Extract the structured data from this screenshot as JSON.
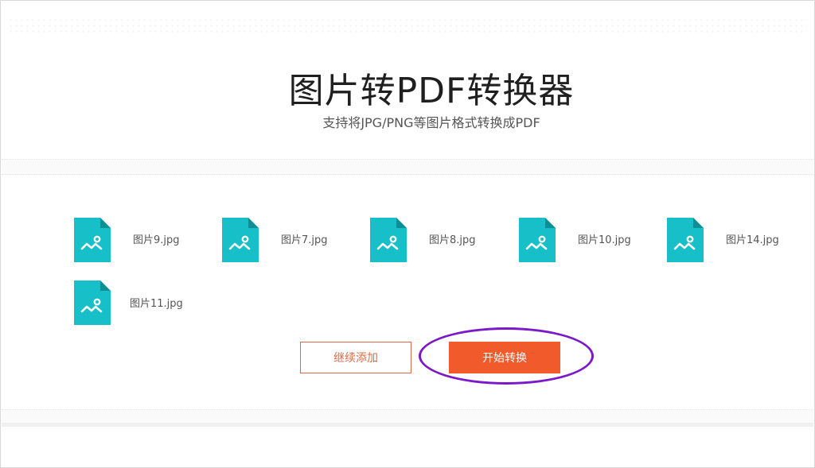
{
  "header": {
    "title": "图片转PDF转换器",
    "subtitle": "支持将JPG/PNG等图片格式转换成PDF"
  },
  "files": [
    {
      "name": "图片9.jpg",
      "icon": "image-file-icon"
    },
    {
      "name": "图片7.jpg",
      "icon": "image-file-icon"
    },
    {
      "name": "图片8.jpg",
      "icon": "image-file-icon"
    },
    {
      "name": "图片10.jpg",
      "icon": "image-file-icon"
    },
    {
      "name": "图片14.jpg",
      "icon": "image-file-icon"
    },
    {
      "name": "图片11.jpg",
      "icon": "image-file-icon"
    }
  ],
  "actions": {
    "add_label": "继续添加",
    "start_label": "开始转换"
  },
  "colors": {
    "icon_teal": "#17c0c8",
    "icon_fold": "#0e8f96",
    "accent_orange": "#f15a2b",
    "highlight_purple": "#7b18c9"
  }
}
